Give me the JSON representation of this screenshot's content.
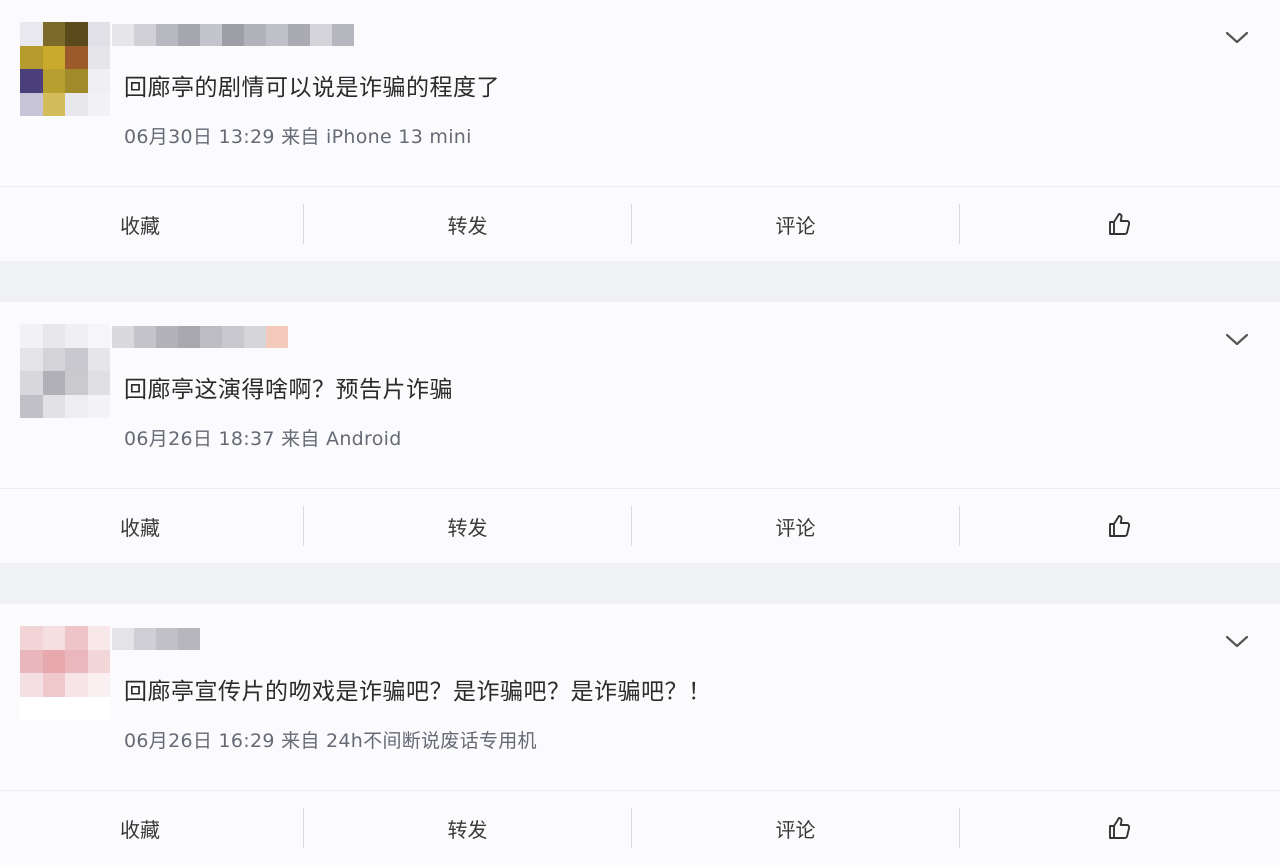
{
  "posts": [
    {
      "comment": "回廊亭的剧情可以说是诈骗的程度了",
      "date": "06月30日 13:29",
      "source": "来自 iPhone 13 mini",
      "avatar_colors": [
        "#e8e8ee",
        "#7b6a2a",
        "#5a4a1c",
        "#e0e0e6",
        "#b59b2e",
        "#c9aa2c",
        "#9c5a2a",
        "#e6e6ea",
        "#4a3f7a",
        "#b8a030",
        "#a08a2a",
        "#f0f0f2",
        "#c8c4d8",
        "#d2bd5a",
        "#e8e8ec",
        "#f2f2f4"
      ],
      "name_colors": [
        "#e6e6ea",
        "#d0d0d6",
        "#b8b8c0",
        "#a6a6ae",
        "#c4c4cc",
        "#9e9ea6",
        "#b2b2ba",
        "#c0c0c8",
        "#aaaab2",
        "#d4d4da",
        "#b6b6be"
      ]
    },
    {
      "comment": "回廊亭这演得啥啊？预告片诈骗",
      "date": "06月26日 18:37",
      "source": "来自 Android",
      "avatar_colors": [
        "#f2f2f4",
        "#e8e8ec",
        "#f0f0f2",
        "#f6f6f8",
        "#e4e4e8",
        "#d4d4d8",
        "#c8c8ce",
        "#e6e6ea",
        "#d8d8dc",
        "#b0b0b6",
        "#cacace",
        "#e0e0e4",
        "#c0c0c6",
        "#e2e2e6",
        "#eeeef0",
        "#f4f4f6"
      ],
      "name_colors": [
        "#dadade",
        "#c4c4ca",
        "#b2b2b8",
        "#a8a8ae",
        "#bcbcc2",
        "#c8c8ce",
        "#d6d6da",
        "#f3c9bc"
      ]
    },
    {
      "comment": "回廊亭宣传片的吻戏是诈骗吧？是诈骗吧？是诈骗吧？！",
      "date": "06月26日 16:29",
      "source": "来自 24h不间断说废话专用机",
      "avatar_colors": [
        "#f3d4d6",
        "#f6dfe1",
        "#eec4c8",
        "#f8e8ea",
        "#e9b6bb",
        "#e7a9ae",
        "#eab8bc",
        "#f2d6d8",
        "#f4e0e2",
        "#eec8cb",
        "#f6e4e6",
        "#fbf0f1",
        "#ffffff",
        "#ffffff",
        "#ffffff",
        "#ffffff"
      ],
      "name_colors": [
        "#e4e4e8",
        "#cfcfd5",
        "#c0c0c6",
        "#b6b6bc"
      ]
    }
  ],
  "actions": {
    "favorite": "收藏",
    "repost": "转发",
    "comment": "评论"
  },
  "icons": {
    "expand": "chevron-down-icon",
    "like": "thumbs-up-icon"
  }
}
